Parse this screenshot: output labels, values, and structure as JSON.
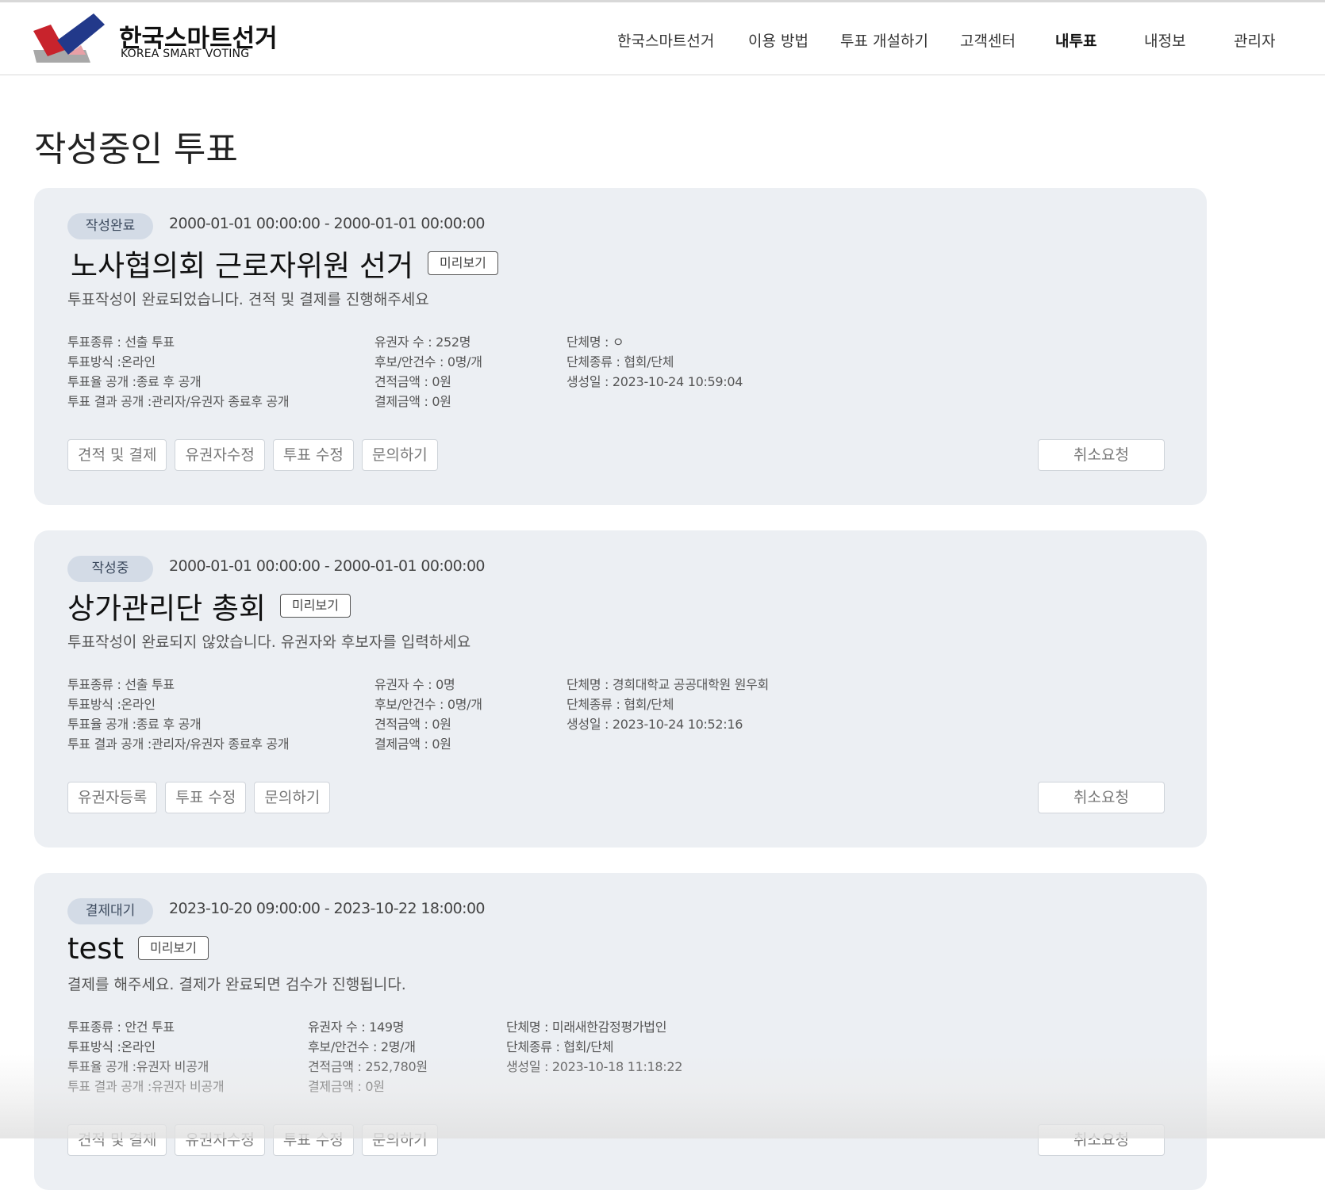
{
  "brand": {
    "name_ko": "한국스마트선거",
    "name_en": "KOREA SMART VOTING"
  },
  "colors": {
    "logo_red": "#c8232c",
    "logo_navy": "#1f3b8a",
    "logo_gray": "#9e9e9e"
  },
  "nav": {
    "items": [
      {
        "label": "한국스마트선거"
      },
      {
        "label": "이용 방법"
      },
      {
        "label": "투표 개설하기"
      },
      {
        "label": "고객센터"
      },
      {
        "label": "내투표",
        "active": true
      },
      {
        "label": "내정보"
      },
      {
        "label": "관리자"
      }
    ]
  },
  "page": {
    "title": "작성중인 투표"
  },
  "common": {
    "preview_label": "미리보기",
    "cancel_label": "취소요청"
  },
  "cards": [
    {
      "status": "작성완료",
      "period": "2000-01-01 00:00:00 - 2000-01-01 00:00:00",
      "title": "노사협의회 근로자위원 선거",
      "desc": "투표작성이 완료되었습니다. 견적 및 결제를 진행해주세요",
      "col1": [
        "투표종류 : 선출 투표",
        "투표방식 :온라인",
        "투표율 공개 :종료 후 공개",
        "투표 결과 공개 :관리자/유권자 종료후 공개"
      ],
      "col2": [
        "유권자 수 : 252명",
        "후보/안건수 : 0명/개",
        "견적금액 : 0원",
        "결제금액 : 0원"
      ],
      "col3": [
        "단체명 : ㅇ",
        "단체종류 : 협회/단체",
        "생성일 : 2023-10-24 10:59:04"
      ],
      "actions": [
        "견적 및 결제",
        "유권자수정",
        "투표 수정",
        "문의하기"
      ]
    },
    {
      "status": "작성중",
      "period": "2000-01-01 00:00:00 - 2000-01-01 00:00:00",
      "title": "상가관리단 총회",
      "desc": "투표작성이 완료되지 않았습니다. 유권자와 후보자를 입력하세요",
      "col1": [
        "투표종류 : 선출 투표",
        "투표방식 :온라인",
        "투표율 공개 :종료 후 공개",
        "투표 결과 공개 :관리자/유권자 종료후 공개"
      ],
      "col2": [
        "유권자 수 : 0명",
        "후보/안건수 : 0명/개",
        "견적금액 : 0원",
        "결제금액 : 0원"
      ],
      "col3": [
        "단체명 : 경희대학교 공공대학원 원우회",
        "단체종류 : 협회/단체",
        "생성일 : 2023-10-24 10:52:16"
      ],
      "actions": [
        "유권자등록",
        "투표 수정",
        "문의하기"
      ]
    },
    {
      "status": "결제대기",
      "period": "2023-10-20 09:00:00 - 2023-10-22 18:00:00",
      "title": "test",
      "desc": "결제를 해주세요. 결제가 완료되면 검수가 진행됩니다.",
      "col1": [
        "투표종류 : 안건 투표",
        "투표방식 :온라인",
        "투표율 공개 :유권자 비공개",
        "투표 결과 공개 :유권자 비공개"
      ],
      "col2": [
        "유권자 수 : 149명",
        "후보/안건수 : 2명/개",
        "견적금액 : 252,780원",
        "결제금액 : 0원"
      ],
      "col3": [
        "단체명 : 미래새한감정평가법인",
        "단체종류 : 협회/단체",
        "생성일 : 2023-10-18 11:18:22"
      ],
      "actions": [
        "견적 및 결제",
        "유권자수정",
        "투표 수정",
        "문의하기"
      ]
    }
  ]
}
